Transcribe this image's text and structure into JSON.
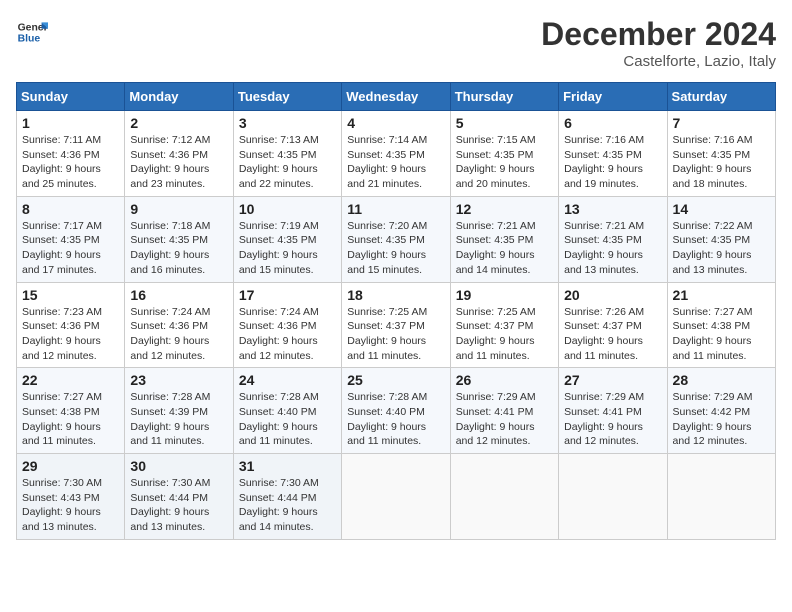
{
  "header": {
    "logo_general": "General",
    "logo_blue": "Blue",
    "month_title": "December 2024",
    "location": "Castelforte, Lazio, Italy"
  },
  "weekdays": [
    "Sunday",
    "Monday",
    "Tuesday",
    "Wednesday",
    "Thursday",
    "Friday",
    "Saturday"
  ],
  "weeks": [
    [
      {
        "day": "1",
        "sunrise": "7:11 AM",
        "sunset": "4:36 PM",
        "daylight": "9 hours and 25 minutes."
      },
      {
        "day": "2",
        "sunrise": "7:12 AM",
        "sunset": "4:36 PM",
        "daylight": "9 hours and 23 minutes."
      },
      {
        "day": "3",
        "sunrise": "7:13 AM",
        "sunset": "4:35 PM",
        "daylight": "9 hours and 22 minutes."
      },
      {
        "day": "4",
        "sunrise": "7:14 AM",
        "sunset": "4:35 PM",
        "daylight": "9 hours and 21 minutes."
      },
      {
        "day": "5",
        "sunrise": "7:15 AM",
        "sunset": "4:35 PM",
        "daylight": "9 hours and 20 minutes."
      },
      {
        "day": "6",
        "sunrise": "7:16 AM",
        "sunset": "4:35 PM",
        "daylight": "9 hours and 19 minutes."
      },
      {
        "day": "7",
        "sunrise": "7:16 AM",
        "sunset": "4:35 PM",
        "daylight": "9 hours and 18 minutes."
      }
    ],
    [
      {
        "day": "8",
        "sunrise": "7:17 AM",
        "sunset": "4:35 PM",
        "daylight": "9 hours and 17 minutes."
      },
      {
        "day": "9",
        "sunrise": "7:18 AM",
        "sunset": "4:35 PM",
        "daylight": "9 hours and 16 minutes."
      },
      {
        "day": "10",
        "sunrise": "7:19 AM",
        "sunset": "4:35 PM",
        "daylight": "9 hours and 15 minutes."
      },
      {
        "day": "11",
        "sunrise": "7:20 AM",
        "sunset": "4:35 PM",
        "daylight": "9 hours and 15 minutes."
      },
      {
        "day": "12",
        "sunrise": "7:21 AM",
        "sunset": "4:35 PM",
        "daylight": "9 hours and 14 minutes."
      },
      {
        "day": "13",
        "sunrise": "7:21 AM",
        "sunset": "4:35 PM",
        "daylight": "9 hours and 13 minutes."
      },
      {
        "day": "14",
        "sunrise": "7:22 AM",
        "sunset": "4:35 PM",
        "daylight": "9 hours and 13 minutes."
      }
    ],
    [
      {
        "day": "15",
        "sunrise": "7:23 AM",
        "sunset": "4:36 PM",
        "daylight": "9 hours and 12 minutes."
      },
      {
        "day": "16",
        "sunrise": "7:24 AM",
        "sunset": "4:36 PM",
        "daylight": "9 hours and 12 minutes."
      },
      {
        "day": "17",
        "sunrise": "7:24 AM",
        "sunset": "4:36 PM",
        "daylight": "9 hours and 12 minutes."
      },
      {
        "day": "18",
        "sunrise": "7:25 AM",
        "sunset": "4:37 PM",
        "daylight": "9 hours and 11 minutes."
      },
      {
        "day": "19",
        "sunrise": "7:25 AM",
        "sunset": "4:37 PM",
        "daylight": "9 hours and 11 minutes."
      },
      {
        "day": "20",
        "sunrise": "7:26 AM",
        "sunset": "4:37 PM",
        "daylight": "9 hours and 11 minutes."
      },
      {
        "day": "21",
        "sunrise": "7:27 AM",
        "sunset": "4:38 PM",
        "daylight": "9 hours and 11 minutes."
      }
    ],
    [
      {
        "day": "22",
        "sunrise": "7:27 AM",
        "sunset": "4:38 PM",
        "daylight": "9 hours and 11 minutes."
      },
      {
        "day": "23",
        "sunrise": "7:28 AM",
        "sunset": "4:39 PM",
        "daylight": "9 hours and 11 minutes."
      },
      {
        "day": "24",
        "sunrise": "7:28 AM",
        "sunset": "4:40 PM",
        "daylight": "9 hours and 11 minutes."
      },
      {
        "day": "25",
        "sunrise": "7:28 AM",
        "sunset": "4:40 PM",
        "daylight": "9 hours and 11 minutes."
      },
      {
        "day": "26",
        "sunrise": "7:29 AM",
        "sunset": "4:41 PM",
        "daylight": "9 hours and 12 minutes."
      },
      {
        "day": "27",
        "sunrise": "7:29 AM",
        "sunset": "4:41 PM",
        "daylight": "9 hours and 12 minutes."
      },
      {
        "day": "28",
        "sunrise": "7:29 AM",
        "sunset": "4:42 PM",
        "daylight": "9 hours and 12 minutes."
      }
    ],
    [
      {
        "day": "29",
        "sunrise": "7:30 AM",
        "sunset": "4:43 PM",
        "daylight": "9 hours and 13 minutes."
      },
      {
        "day": "30",
        "sunrise": "7:30 AM",
        "sunset": "4:44 PM",
        "daylight": "9 hours and 13 minutes."
      },
      {
        "day": "31",
        "sunrise": "7:30 AM",
        "sunset": "4:44 PM",
        "daylight": "9 hours and 14 minutes."
      },
      null,
      null,
      null,
      null
    ]
  ],
  "labels": {
    "sunrise": "Sunrise:",
    "sunset": "Sunset:",
    "daylight": "Daylight:"
  }
}
